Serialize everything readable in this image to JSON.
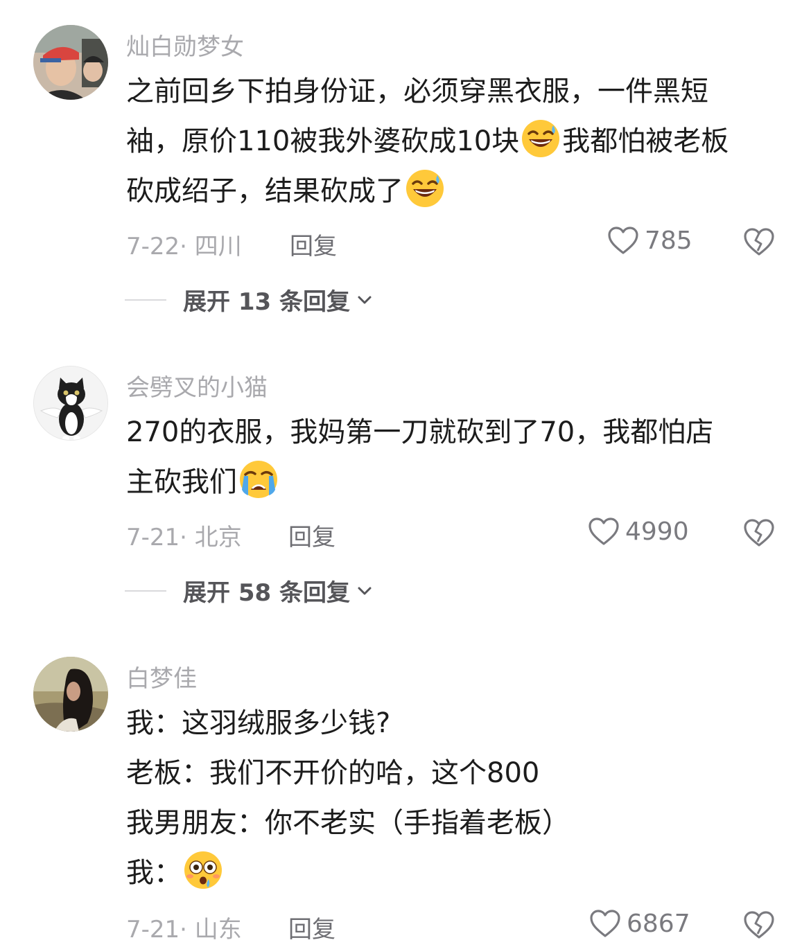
{
  "comments": [
    {
      "username": "灿白勋梦女",
      "lines": [
        {
          "parts": [
            "之前回乡下拍身份证，必须穿黑衣服，一件黑短"
          ]
        },
        {
          "parts": [
            "袖，原价110被我外婆砍成10块",
            "我都怕被老板"
          ]
        },
        {
          "parts": [
            "砍成绍子，结果砍成了"
          ]
        }
      ],
      "date_location": "7-22· 四川",
      "reply_label": "回复",
      "likes": "785",
      "expand_label": "展开 13 条回复"
    },
    {
      "username": "会劈叉的小猫",
      "lines": [
        {
          "parts": [
            "270的衣服，我妈第一刀就砍到了70，我都怕店"
          ]
        },
        {
          "parts": [
            "主砍我们"
          ]
        }
      ],
      "date_location": "7-21· 北京",
      "reply_label": "回复",
      "likes": "4990",
      "expand_label": "展开 58 条回复"
    },
    {
      "username": "白梦佳",
      "lines": [
        {
          "parts": [
            "我：这羽绒服多少钱?"
          ]
        },
        {
          "parts": [
            "老板：我们不开价的哈，这个800"
          ]
        },
        {
          "parts": [
            "我男朋友：你不老实（手指着老板）"
          ]
        },
        {
          "parts": [
            "我："
          ]
        }
      ],
      "date_location": "7-21· 山东",
      "reply_label": "回复",
      "likes": "6867"
    }
  ],
  "icons": {
    "like": "heart-outline-icon",
    "dislike": "broken-heart-icon",
    "expand": "chevron-down-icon",
    "emoji_grin": "grinning-sweat-emoji",
    "emoji_cry": "loudly-crying-emoji",
    "emoji_flushed": "flushed-emoji"
  },
  "colors": {
    "text": "#1c1c1c",
    "muted": "#a9a9ad",
    "reply": "#6e6e73"
  }
}
